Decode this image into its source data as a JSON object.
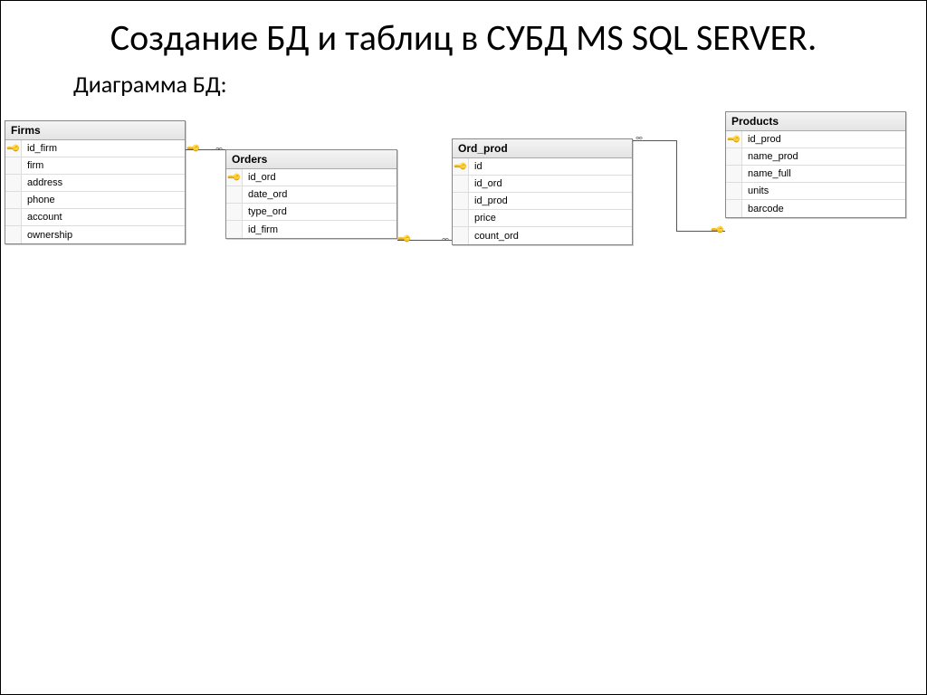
{
  "title": "Создание БД и таблиц в СУБД MS SQL SERVER.",
  "subtitle": "Диаграмма БД:",
  "tables": {
    "firms": {
      "name": "Firms",
      "cols": [
        {
          "label": "id_firm",
          "pk": true
        },
        {
          "label": "firm",
          "pk": false
        },
        {
          "label": "address",
          "pk": false
        },
        {
          "label": "phone",
          "pk": false
        },
        {
          "label": "account",
          "pk": false
        },
        {
          "label": "ownership",
          "pk": false
        }
      ]
    },
    "orders": {
      "name": "Orders",
      "cols": [
        {
          "label": "id_ord",
          "pk": true
        },
        {
          "label": "date_ord",
          "pk": false
        },
        {
          "label": "type_ord",
          "pk": false
        },
        {
          "label": "id_firm",
          "pk": false
        }
      ]
    },
    "ord_prod": {
      "name": "Ord_prod",
      "cols": [
        {
          "label": "id",
          "pk": true
        },
        {
          "label": "id_ord",
          "pk": false
        },
        {
          "label": "id_prod",
          "pk": false
        },
        {
          "label": "price",
          "pk": false
        },
        {
          "label": "count_ord",
          "pk": false
        }
      ]
    },
    "products": {
      "name": "Products",
      "cols": [
        {
          "label": "id_prod",
          "pk": true
        },
        {
          "label": "name_prod",
          "pk": false
        },
        {
          "label": "name_full",
          "pk": false
        },
        {
          "label": "units",
          "pk": false
        },
        {
          "label": "barcode",
          "pk": false
        }
      ]
    }
  },
  "key_glyph": "🔑",
  "fk_glyph": "∞"
}
